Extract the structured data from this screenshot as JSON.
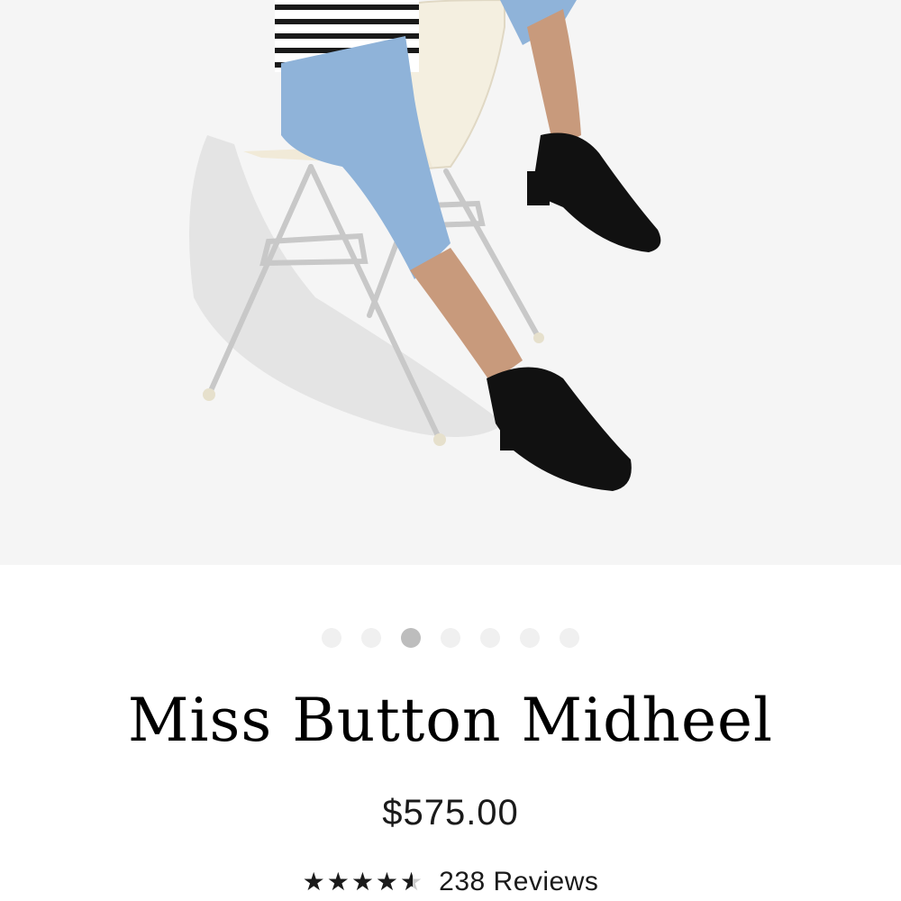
{
  "product": {
    "title": "Miss Button Midheel",
    "price": "$575.00",
    "rating": 4.5,
    "reviews_label": "238 Reviews"
  },
  "carousel": {
    "count": 7,
    "active_index": 2
  },
  "icons": {
    "star": "star-icon",
    "half_star": "half-star-icon"
  },
  "colors": {
    "background": "#ffffff",
    "photo_background": "#f5f5f5",
    "dot_inactive": "#f0f0f0",
    "dot_active": "#bdbdbd",
    "text": "#000000"
  }
}
